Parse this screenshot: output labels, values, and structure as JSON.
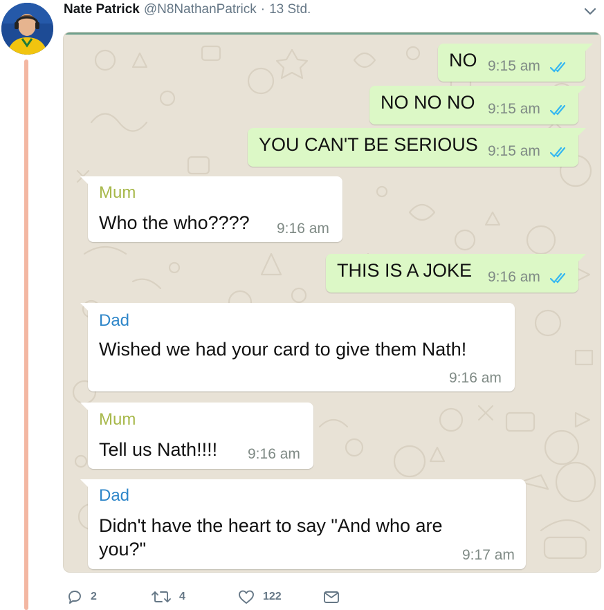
{
  "tweet": {
    "author_name": "Nate Patrick",
    "handle": "@N8NathanPatrick",
    "separator": "·",
    "time_ago": "13 Std."
  },
  "chat": {
    "messages": [
      {
        "direction": "outgoing",
        "text": "NO",
        "time": "9:15 am",
        "read_receipt": "blue-double-check"
      },
      {
        "direction": "outgoing",
        "text": "NO NO NO",
        "time": "9:15 am",
        "read_receipt": "blue-double-check"
      },
      {
        "direction": "outgoing",
        "text": "YOU CAN'T BE SERIOUS",
        "time": "9:15 am",
        "read_receipt": "blue-double-check"
      },
      {
        "direction": "incoming",
        "sender": "Mum",
        "text": "Who the who????",
        "time": "9:16 am"
      },
      {
        "direction": "outgoing",
        "text": "THIS IS A JOKE",
        "time": "9:16 am",
        "read_receipt": "blue-double-check"
      },
      {
        "direction": "incoming",
        "sender": "Dad",
        "text": "Wished we had your card to give them Nath!",
        "time": "9:16 am"
      },
      {
        "direction": "incoming",
        "sender": "Mum",
        "text": "Tell us Nath!!!!",
        "time": "9:16 am"
      },
      {
        "direction": "incoming",
        "sender": "Dad",
        "text_line1": "Didn't have the heart to say \"And who are",
        "text_line2": "you?\"",
        "time": "9:17 am"
      }
    ]
  },
  "actions": {
    "reply_count": "2",
    "retweet_count": "4",
    "like_count": "122"
  },
  "icons": {
    "reply": "reply-icon",
    "retweet": "retweet-icon",
    "like": "heart-icon",
    "message": "envelope-icon",
    "menu": "chevron-down-icon"
  },
  "colors": {
    "outgoing_bubble": "#dcf8c6",
    "incoming_bubble": "#ffffff",
    "chat_background": "#e8e2d6",
    "mum_name": "#a7b84a",
    "dad_name": "#2e86c9",
    "read_ticks": "#34b7f1",
    "thread_line": "#f3b7a2"
  }
}
